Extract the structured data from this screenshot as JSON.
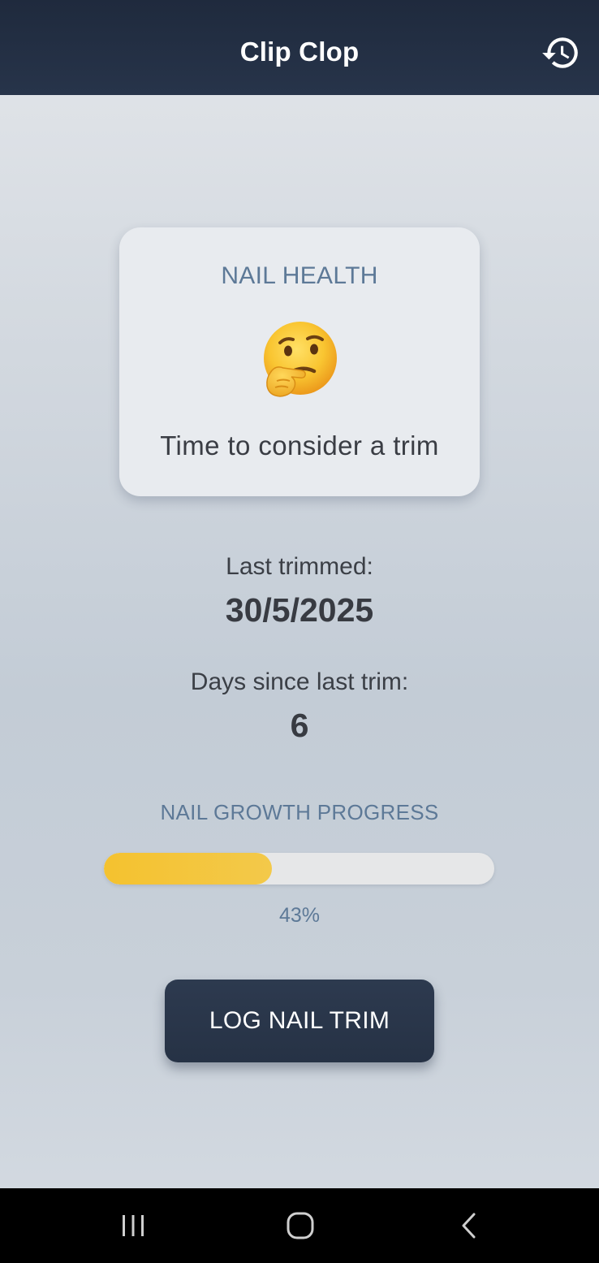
{
  "app_bar": {
    "title": "Clip Clop",
    "history_icon": "history-icon"
  },
  "health_card": {
    "title": "NAIL HEALTH",
    "emoji_icon": "thinking-face-emoji",
    "message": "Time to consider a trim"
  },
  "last_trimmed": {
    "label": "Last trimmed:",
    "value": "30/5/2025"
  },
  "days_since": {
    "label": "Days since last trim:",
    "value": "6"
  },
  "growth": {
    "title": "NAIL GROWTH PROGRESS",
    "percent_label": "43%",
    "progress_fraction": 0.43,
    "fill_color": "#f4c22f",
    "track_color": "#e6e7e8"
  },
  "log_button": {
    "label": "LOG NAIL TRIM",
    "color": "#2b3749"
  },
  "system_nav": {
    "recents_icon": "recents-icon",
    "home_icon": "home-icon",
    "back_icon": "back-icon"
  },
  "colors": {
    "app_bar": "#222e42",
    "accent_text": "#5d7997",
    "primary_text": "#3a3d44"
  }
}
